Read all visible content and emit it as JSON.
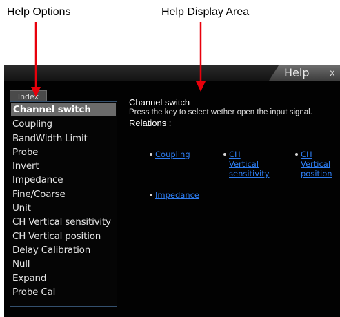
{
  "callouts": {
    "left": "Help Options",
    "right": "Help Display Area"
  },
  "window": {
    "title": "Help",
    "close_glyph": "x"
  },
  "index": {
    "tab_label": "Index",
    "selected_index": 0,
    "items": [
      "Channel switch",
      "Coupling",
      "BandWidth Limit",
      "Probe",
      "Invert",
      "Impedance",
      "Fine/Coarse",
      "Unit",
      "CH Vertical sensitivity",
      "CH Vertical position",
      "Delay Calibration",
      "Null",
      "Expand",
      "Probe Cal"
    ]
  },
  "content": {
    "title": "Channel switch",
    "description": "Press the key to select wether open the input signal.",
    "relations_label": "Relations :",
    "relations": [
      {
        "lines": [
          "Coupling"
        ]
      },
      {
        "lines": [
          "CH",
          "Vertical",
          "sensitivity"
        ]
      },
      {
        "lines": [
          "CH",
          "Vertical",
          "position"
        ]
      },
      {
        "lines": [
          "Impedance"
        ]
      }
    ]
  },
  "colors": {
    "callout_arrow": "#e8000b",
    "link": "#2d7cf0",
    "selected_item_bg": "#6b6b6b"
  }
}
